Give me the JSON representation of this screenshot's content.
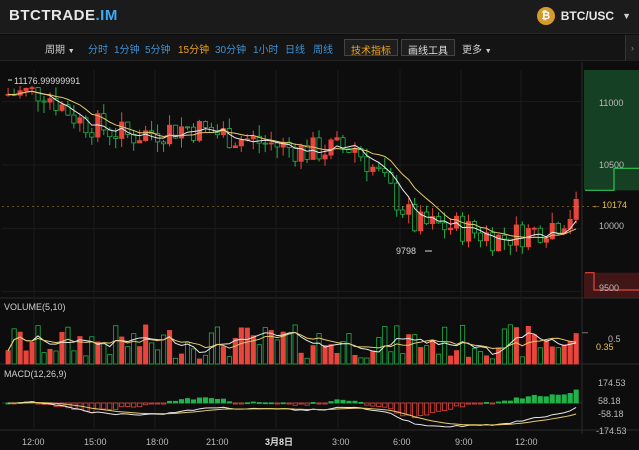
{
  "app": {
    "logo_main": "BTCTRADE",
    "logo_suffix": ".IM",
    "coin_glyph": "₿",
    "pair": "BTC/USC"
  },
  "toolbar": {
    "period_label": "周期",
    "intervals": [
      "分时",
      "1分钟",
      "5分钟",
      "15分钟",
      "30分钟",
      "1小时",
      "日线",
      "周线"
    ],
    "active_interval": "15分钟",
    "indicators_button": "技术指标",
    "drawing_button": "画线工具",
    "more_button": "更多"
  },
  "colors": {
    "up": "#e8453c",
    "down": "#21b24b",
    "ma_short": "#e9e9e9",
    "ma_long": "#e7cb6a",
    "interval_text": "#3f93d6",
    "active_interval": "#f0a21c"
  },
  "chart_data": {
    "type": "candlestick",
    "main": {
      "high_marker_label": "11176.99999991",
      "low_marker_label": "9798",
      "current_price_label": "10174",
      "y_ticks": [
        "11000",
        "10500",
        "10000",
        "9500"
      ],
      "y_range": [
        9450,
        11250
      ],
      "depth_levels": [
        {
          "price": 10300,
          "side": "bid"
        },
        {
          "price": 9650,
          "side": "ask"
        }
      ]
    },
    "volume": {
      "label": "VOLUME(5,10)",
      "y_ticks": [
        "0.5"
      ],
      "current_label": "0.35",
      "y_range": [
        0,
        0.8
      ]
    },
    "macd": {
      "label": "MACD(12,26,9)",
      "y_ticks": [
        "174.53",
        "58.18",
        "-58.18",
        "-174.53"
      ],
      "y_range": [
        -190,
        190
      ]
    },
    "x_ticks": [
      "12:00",
      "15:00",
      "18:00",
      "21:00",
      "3月8日",
      "3:00",
      "6:00",
      "9:00",
      "12:00"
    ]
  }
}
